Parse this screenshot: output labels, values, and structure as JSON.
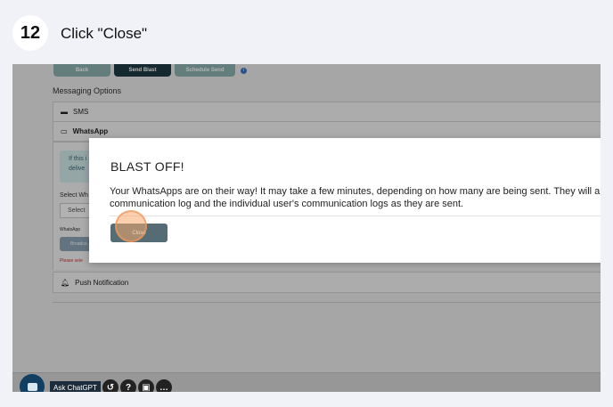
{
  "step": {
    "number": "12",
    "title": "Click \"Close\""
  },
  "toolbar": {
    "back": "Back",
    "send_blast": "Send Blast",
    "schedule_send": "Schedule Send",
    "info": "i"
  },
  "messaging": {
    "title": "Messaging Options",
    "sms": "SMS",
    "whatsapp": "WhatsApp",
    "alert_line1": "If this i",
    "alert_line2": "delive",
    "select_label": "Select Wh",
    "select_value": "Select",
    "wa_label": "WhatsApp",
    "broadcast": "Broadca",
    "error": "Please sele",
    "push": "Push Notification"
  },
  "modal": {
    "title": "BLAST OFF!",
    "message_line1": "Your WhatsApps are on their way! It may take a few minutes, depending on how many are being sent. They will appe",
    "message_line2": "communication log and the individual user's communication logs as they are sent.",
    "close_label": "Close"
  },
  "bottom": {
    "ask": "Ask ChatGPT",
    "more": "…"
  }
}
